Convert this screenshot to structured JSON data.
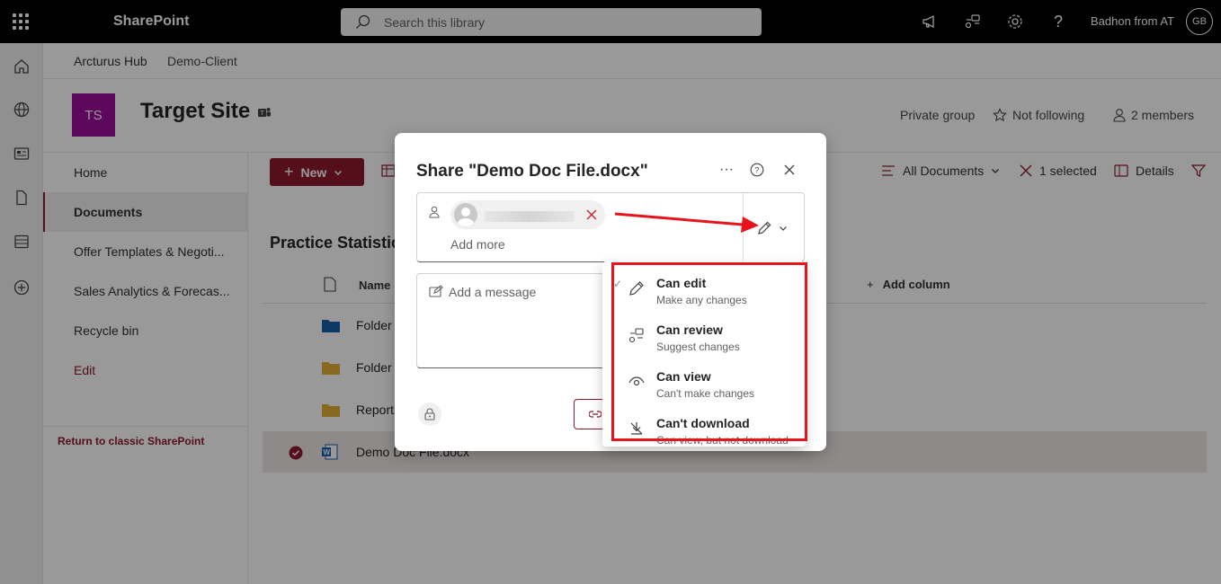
{
  "topbar": {
    "app_name": "SharePoint",
    "search_placeholder": "Search this library",
    "user_name": "Badhon from AT",
    "avatar_initials": "GB"
  },
  "hub": {
    "title": "Arcturus Hub",
    "link": "Demo-Client"
  },
  "site": {
    "logo_initials": "TS",
    "title": "Target Site",
    "privacy": "Private group",
    "follow": "Not following",
    "members": "2 members"
  },
  "leftnav": {
    "items": [
      {
        "label": "Home"
      },
      {
        "label": "Documents"
      },
      {
        "label": "Offer Templates & Negoti..."
      },
      {
        "label": "Sales Analytics & Forecas..."
      },
      {
        "label": "Recycle bin"
      },
      {
        "label": "Edit"
      }
    ],
    "classic_link": "Return to classic SharePoint"
  },
  "cmdbar": {
    "new_label": "New",
    "view_label": "All Documents",
    "selected_label": "1 selected",
    "details_label": "Details"
  },
  "library": {
    "title": "Practice Statistics",
    "col_name": "Name",
    "add_column": "Add column",
    "rows": [
      {
        "name": "Folder"
      },
      {
        "name": "Folder"
      },
      {
        "name": "Reports"
      },
      {
        "name": "Demo Doc File.docx"
      }
    ]
  },
  "dialog": {
    "title": "Share \"Demo Doc File.docx\"",
    "add_more": "Add more",
    "message_placeholder": "Add a message"
  },
  "permissions_menu": {
    "items": [
      {
        "label": "Can edit",
        "desc": "Make any changes"
      },
      {
        "label": "Can review",
        "desc": "Suggest changes"
      },
      {
        "label": "Can view",
        "desc": "Can't make changes"
      },
      {
        "label": "Can't download",
        "desc": "Can view, but not download"
      }
    ]
  },
  "colors": {
    "brand": "#8e192e",
    "site_logo": "#9c0e9c",
    "annotation": "#e8141c"
  }
}
